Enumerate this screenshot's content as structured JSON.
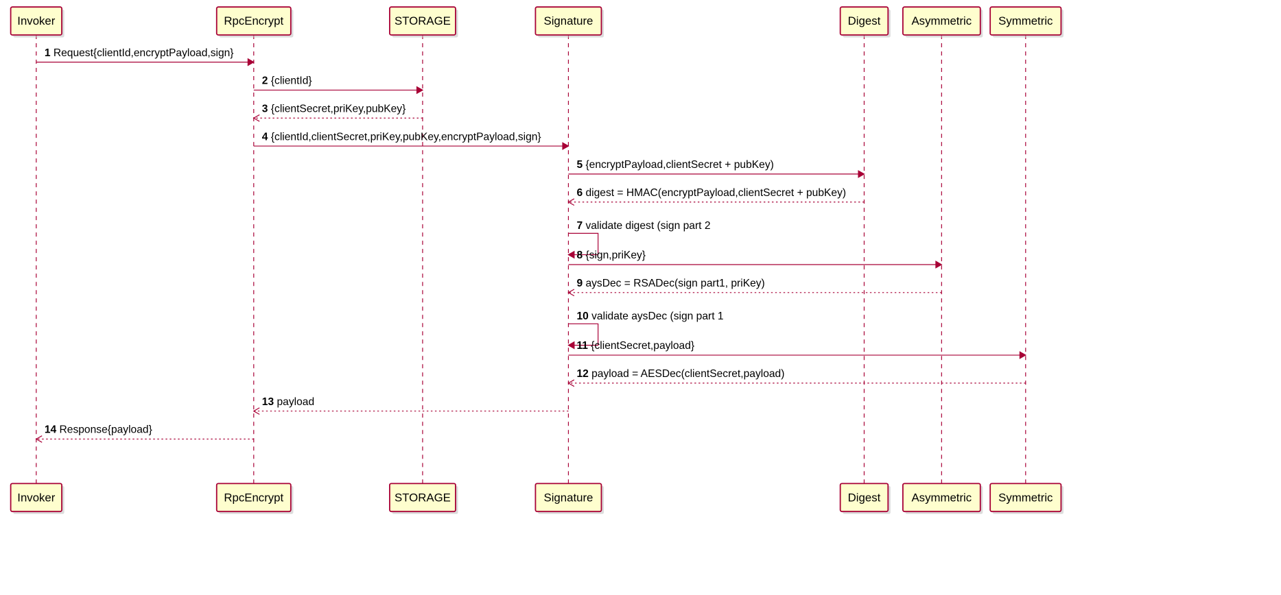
{
  "chart_data": {
    "type": "sequence-diagram",
    "participants": [
      {
        "id": "invoker",
        "label": "Invoker"
      },
      {
        "id": "rpc",
        "label": "RpcEncrypt"
      },
      {
        "id": "storage",
        "label": "STORAGE"
      },
      {
        "id": "signature",
        "label": "Signature"
      },
      {
        "id": "digest",
        "label": "Digest"
      },
      {
        "id": "asymmetric",
        "label": "Asymmetric"
      },
      {
        "id": "symmetric",
        "label": "Symmetric"
      }
    ],
    "messages": [
      {
        "n": 1,
        "from": "invoker",
        "to": "rpc",
        "kind": "call",
        "label": "Request{clientId,encryptPayload,sign}"
      },
      {
        "n": 2,
        "from": "rpc",
        "to": "storage",
        "kind": "call",
        "label": "{clientId}"
      },
      {
        "n": 3,
        "from": "storage",
        "to": "rpc",
        "kind": "return",
        "label": "{clientSecret,priKey,pubKey}"
      },
      {
        "n": 4,
        "from": "rpc",
        "to": "signature",
        "kind": "call",
        "label": "{clientId,clientSecret,priKey,pubKey,encryptPayload,sign}"
      },
      {
        "n": 5,
        "from": "signature",
        "to": "digest",
        "kind": "call",
        "label": "{encryptPayload,clientSecret + pubKey)"
      },
      {
        "n": 6,
        "from": "digest",
        "to": "signature",
        "kind": "return",
        "label": "digest = HMAC(encryptPayload,clientSecret + pubKey)"
      },
      {
        "n": 7,
        "from": "signature",
        "to": "signature",
        "kind": "self",
        "label": "validate digest (sign part 2"
      },
      {
        "n": 8,
        "from": "signature",
        "to": "asymmetric",
        "kind": "call",
        "label": "{sign,priKey}"
      },
      {
        "n": 9,
        "from": "asymmetric",
        "to": "signature",
        "kind": "return",
        "label": "aysDec = RSADec(sign part1, priKey)"
      },
      {
        "n": 10,
        "from": "signature",
        "to": "signature",
        "kind": "self",
        "label": "validate aysDec (sign part 1"
      },
      {
        "n": 11,
        "from": "signature",
        "to": "symmetric",
        "kind": "call",
        "label": "{clientSecret,payload}"
      },
      {
        "n": 12,
        "from": "symmetric",
        "to": "signature",
        "kind": "return",
        "label": "payload = AESDec(clientSecret,payload)"
      },
      {
        "n": 13,
        "from": "signature",
        "to": "rpc",
        "kind": "return",
        "label": "payload"
      },
      {
        "n": 14,
        "from": "rpc",
        "to": "invoker",
        "kind": "return",
        "label": "Response{payload}"
      }
    ]
  }
}
